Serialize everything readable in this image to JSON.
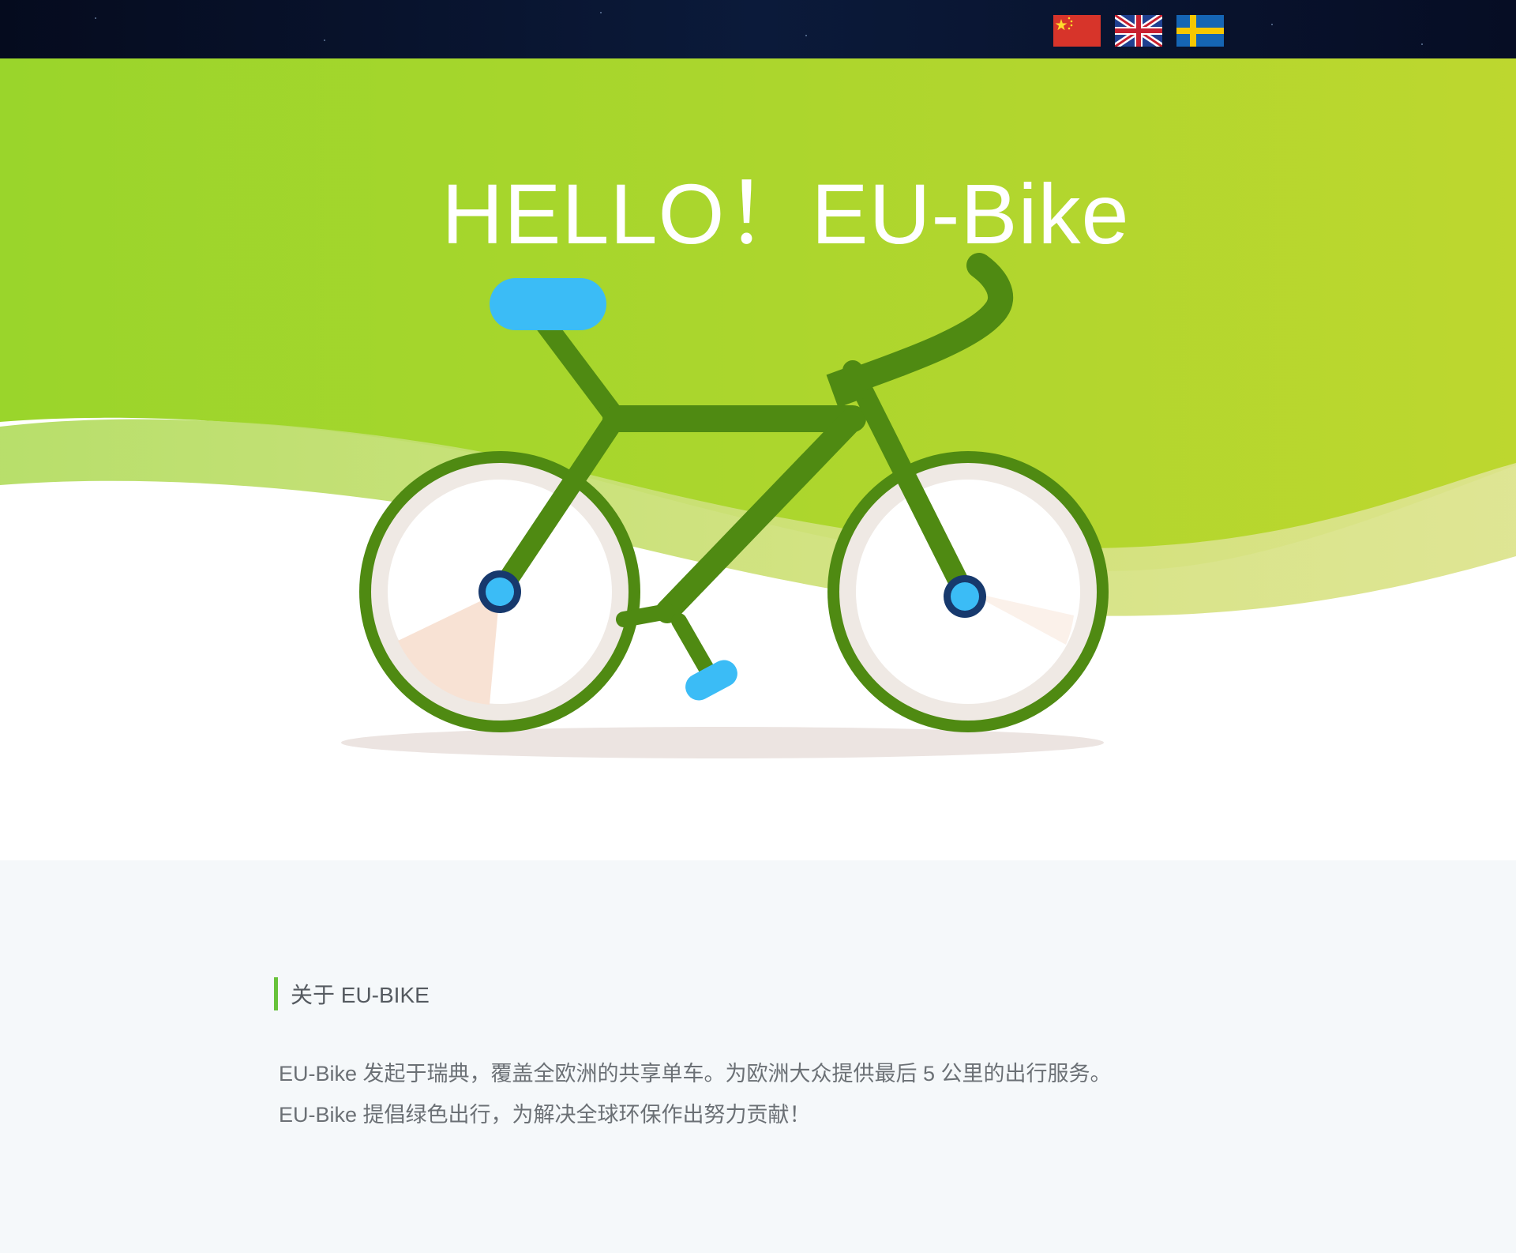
{
  "header": {
    "languages": [
      {
        "name": "zh",
        "flag": "china-flag-icon"
      },
      {
        "name": "en",
        "flag": "uk-flag-icon"
      },
      {
        "name": "sv",
        "flag": "sweden-flag-icon"
      }
    ]
  },
  "hero": {
    "title": "HELLO！EU-Bike",
    "illustration": "bicycle-illustration",
    "colors": {
      "green_start": "#9ad52b",
      "green_end": "#bdd72f",
      "frame": "#4f8a12",
      "accent_blue": "#3bbcf6"
    }
  },
  "about": {
    "heading": "关于 EU-BIKE",
    "paragraphs": [
      "EU-Bike 发起于瑞典，覆盖全欧洲的共享单车。为欧洲大众提供最后 5 公里的出行服务。",
      "EU-Bike 提倡绿色出行，为解决全球环保作出努力贡献！"
    ]
  }
}
